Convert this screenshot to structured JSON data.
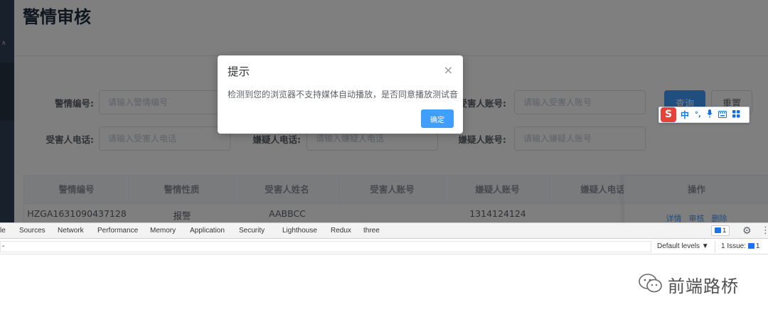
{
  "page": {
    "title": "警情审核"
  },
  "search_form": {
    "alarm_no": {
      "label": "警情编号:",
      "placeholder": "请输入警情编号"
    },
    "victim_account": {
      "label": "受害人账号:",
      "placeholder": "请输入受害人账号"
    },
    "victim_phone": {
      "label": "受害人电话:",
      "placeholder": "请输入受害人电话"
    },
    "suspect_phone": {
      "label": "嫌疑人电话:",
      "placeholder": "请输入嫌疑人电话"
    },
    "suspect_account": {
      "label": "嫌疑人账号:",
      "placeholder": "请输入嫌疑人账号"
    },
    "query_button": "查询",
    "reset_button": "重置"
  },
  "table": {
    "columns": [
      "警情编号",
      "警情性质",
      "受害人姓名",
      "受害人账号",
      "嫌疑人账号",
      "嫌疑人电话",
      "操作"
    ],
    "rows": [
      {
        "alarm_no": "HZGA1631090437128",
        "nature": "报警",
        "victim_name": "AABBCC",
        "victim_account": "",
        "suspect_account": "1314124124",
        "suspect_phone": "",
        "actions": [
          "详情",
          "审核",
          "删除"
        ]
      }
    ]
  },
  "dialog": {
    "title": "提示",
    "message": "检测到您的浏览器不支持媒体自动播放，是否同意播放测试音",
    "ok_button": "确定",
    "close_icon": "×"
  },
  "ime_toolbar": {
    "logo": "S",
    "mode": "中",
    "punct": "°,",
    "mic_icon": "microphone-icon",
    "keyboard_icon": "keyboard-icon",
    "apps_icon": "grid-icon"
  },
  "devtools": {
    "tabs": [
      "le",
      "Sources",
      "Network",
      "Performance",
      "Memory",
      "Application",
      "Security",
      "Lighthouse",
      "Redux",
      "three"
    ],
    "messages_badge": "1",
    "filter_text": "-",
    "default_levels": "Default levels ▼",
    "issues_label": "1 Issue:",
    "issues_count": "1"
  },
  "watermark": {
    "text": "前端路桥"
  },
  "colors": {
    "primary": "#409eff",
    "sidebar": "#304156",
    "overlay": "rgba(0,0,0,0.5)",
    "ime_red": "#e8413a"
  }
}
